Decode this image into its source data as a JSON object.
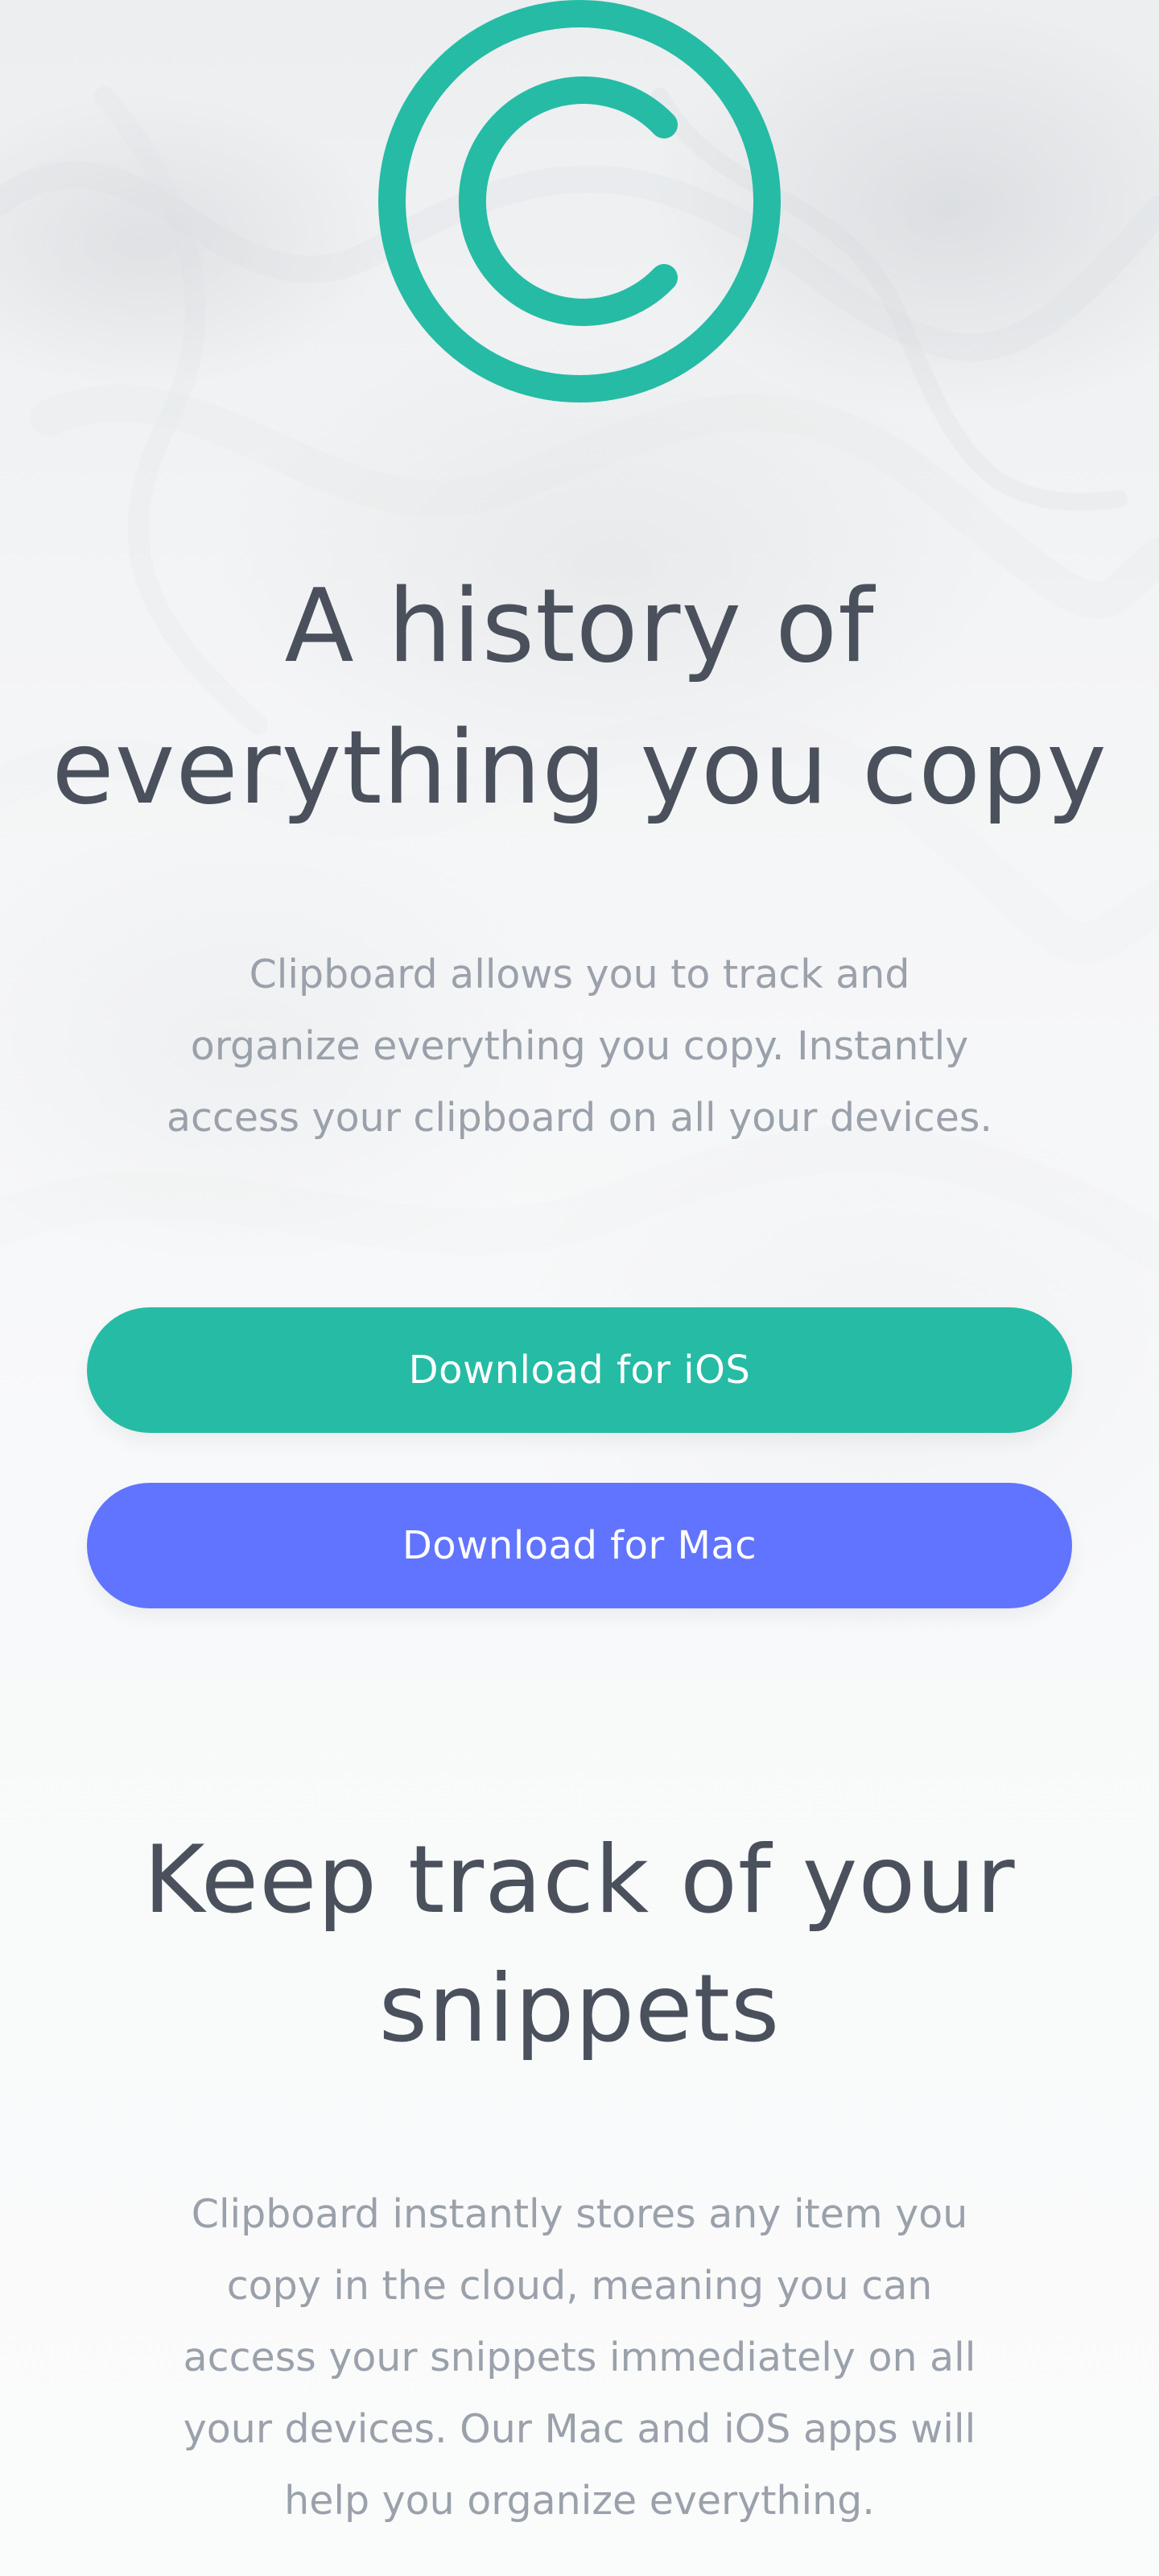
{
  "app": {
    "logo_icon": "clipboard-c-logo-icon",
    "accent_color": "#26bba5",
    "secondary_color": "#6174ff",
    "heading_color": "#4a515c",
    "body_text_color": "#9aa1ab"
  },
  "hero": {
    "title_line_1": "A history of",
    "title_line_2": "everything you copy",
    "description_line_1": "Clipboard allows you to track and",
    "description_line_2": "organize everything you copy. Instantly",
    "description_line_3": "access your clipboard on all your devices."
  },
  "actions": {
    "ios_label": "Download for iOS",
    "mac_label": "Download for Mac"
  },
  "snippets_section": {
    "title_line_1": "Keep track of your",
    "title_line_2": "snippets",
    "description_line_1": "Clipboard instantly stores any item you",
    "description_line_2": "copy in the cloud, meaning you can",
    "description_line_3": "access your snippets immediately on all",
    "description_line_4": "your devices. Our Mac and iOS apps will",
    "description_line_5": "help you organize everything."
  }
}
